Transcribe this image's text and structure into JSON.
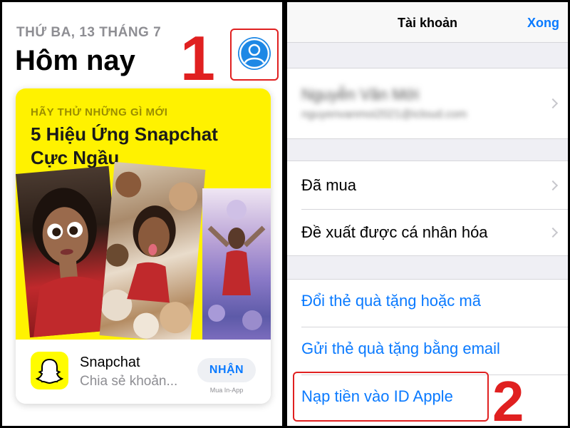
{
  "left": {
    "date": "THỨ BA, 13 THÁNG 7",
    "title": "Hôm nay",
    "step_marker": "1",
    "card": {
      "eyebrow": "HÃY THỬ NHỮNG GÌ MỚI",
      "headline": "5 Hiệu Ứng Snapchat Cực Ngầu",
      "app": {
        "name": "Snapchat",
        "subtitle": "Chia sẻ khoản...",
        "get_label": "NHẬN",
        "in_app_note": "Mua In-App"
      }
    }
  },
  "right": {
    "nav": {
      "title": "Tài khoản",
      "done_label": "Xong"
    },
    "account": {
      "name": "Nguyễn Văn Mới",
      "email": "nguyenvanmoi2021@icloud.com"
    },
    "rows": [
      {
        "label": "Đã mua"
      },
      {
        "label": "Đề xuất được cá nhân hóa"
      }
    ],
    "links": [
      {
        "label": "Đổi thẻ quà tặng hoặc mã"
      },
      {
        "label": "Gửi thẻ quà tặng bằng email"
      },
      {
        "label": "Nạp tiền vào ID Apple"
      }
    ],
    "step_marker": "2"
  },
  "colors": {
    "accent": "#0a7aff",
    "annotation_red": "#e02020",
    "card_yellow": "#fff200",
    "avatar_blue": "#1e88e5"
  },
  "icons": {
    "avatar": "person-circle-icon",
    "app": "snapchat-ghost-icon",
    "chevron": "chevron-right-icon"
  }
}
